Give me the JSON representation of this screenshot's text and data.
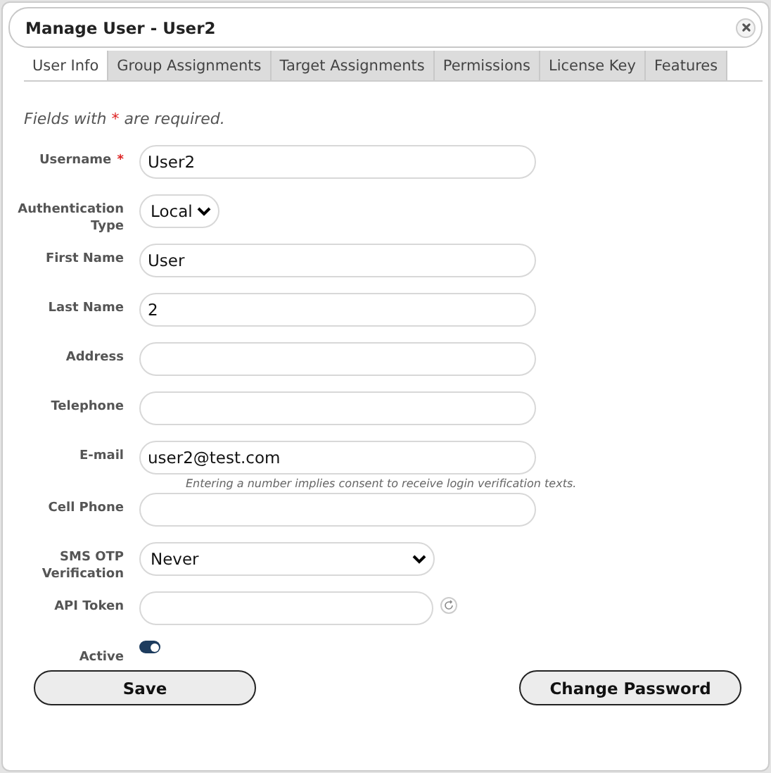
{
  "window": {
    "title": "Manage User - User2"
  },
  "tabs": [
    {
      "label": "User Info",
      "selected": true
    },
    {
      "label": "Group Assignments",
      "selected": false
    },
    {
      "label": "Target Assignments",
      "selected": false
    },
    {
      "label": "Permissions",
      "selected": false
    },
    {
      "label": "License Key",
      "selected": false
    },
    {
      "label": "Features",
      "selected": false
    }
  ],
  "required_note": {
    "before": "Fields with",
    "mark": "*",
    "after": "are required."
  },
  "fields": [
    {
      "kind": "text",
      "label": "Username",
      "required": true,
      "value": "User2"
    },
    {
      "kind": "select",
      "label": "Authentication Type",
      "required": false,
      "value": "Local"
    },
    {
      "kind": "text",
      "label": "First Name",
      "required": false,
      "value": "User"
    },
    {
      "kind": "text",
      "label": "Last Name",
      "required": false,
      "value": "2"
    },
    {
      "kind": "text",
      "label": "Address",
      "required": false
    },
    {
      "kind": "text",
      "label": "Telephone",
      "required": false
    },
    {
      "kind": "text",
      "label": "E-mail",
      "required": false,
      "value": "user2@test.com"
    },
    {
      "kind": "text",
      "label": "Cell Phone",
      "required": false,
      "note": "Entering a number implies consent to receive login verification texts."
    },
    {
      "kind": "wideselect",
      "label": "SMS OTP Verification",
      "required": false,
      "value": "Never"
    },
    {
      "kind": "token",
      "label": "API Token",
      "required": false
    },
    {
      "kind": "toggle",
      "label": "Active",
      "required": false,
      "on": true
    }
  ],
  "buttons": [
    "Save",
    "Change Password"
  ]
}
